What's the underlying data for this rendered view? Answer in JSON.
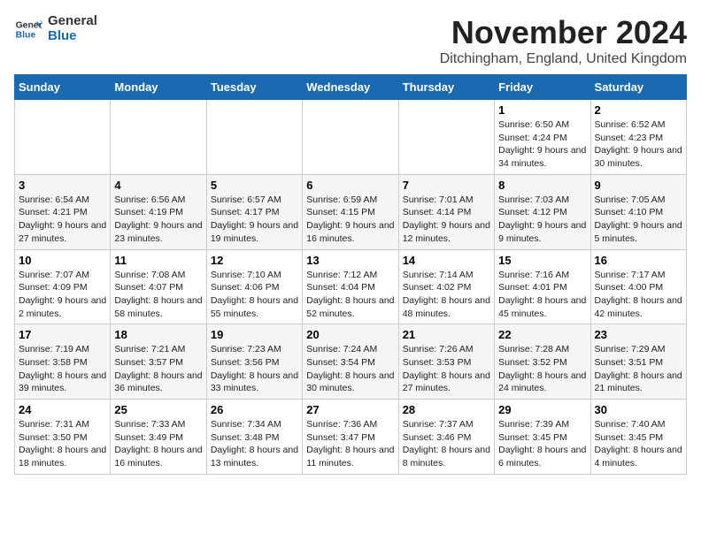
{
  "header": {
    "logo_line1": "General",
    "logo_line2": "Blue",
    "month_title": "November 2024",
    "location": "Ditchingham, England, United Kingdom"
  },
  "days_of_week": [
    "Sunday",
    "Monday",
    "Tuesday",
    "Wednesday",
    "Thursday",
    "Friday",
    "Saturday"
  ],
  "weeks": [
    [
      {
        "day": "",
        "info": ""
      },
      {
        "day": "",
        "info": ""
      },
      {
        "day": "",
        "info": ""
      },
      {
        "day": "",
        "info": ""
      },
      {
        "day": "",
        "info": ""
      },
      {
        "day": "1",
        "info": "Sunrise: 6:50 AM\nSunset: 4:24 PM\nDaylight: 9 hours and 34 minutes."
      },
      {
        "day": "2",
        "info": "Sunrise: 6:52 AM\nSunset: 4:23 PM\nDaylight: 9 hours and 30 minutes."
      }
    ],
    [
      {
        "day": "3",
        "info": "Sunrise: 6:54 AM\nSunset: 4:21 PM\nDaylight: 9 hours and 27 minutes."
      },
      {
        "day": "4",
        "info": "Sunrise: 6:56 AM\nSunset: 4:19 PM\nDaylight: 9 hours and 23 minutes."
      },
      {
        "day": "5",
        "info": "Sunrise: 6:57 AM\nSunset: 4:17 PM\nDaylight: 9 hours and 19 minutes."
      },
      {
        "day": "6",
        "info": "Sunrise: 6:59 AM\nSunset: 4:15 PM\nDaylight: 9 hours and 16 minutes."
      },
      {
        "day": "7",
        "info": "Sunrise: 7:01 AM\nSunset: 4:14 PM\nDaylight: 9 hours and 12 minutes."
      },
      {
        "day": "8",
        "info": "Sunrise: 7:03 AM\nSunset: 4:12 PM\nDaylight: 9 hours and 9 minutes."
      },
      {
        "day": "9",
        "info": "Sunrise: 7:05 AM\nSunset: 4:10 PM\nDaylight: 9 hours and 5 minutes."
      }
    ],
    [
      {
        "day": "10",
        "info": "Sunrise: 7:07 AM\nSunset: 4:09 PM\nDaylight: 9 hours and 2 minutes."
      },
      {
        "day": "11",
        "info": "Sunrise: 7:08 AM\nSunset: 4:07 PM\nDaylight: 8 hours and 58 minutes."
      },
      {
        "day": "12",
        "info": "Sunrise: 7:10 AM\nSunset: 4:06 PM\nDaylight: 8 hours and 55 minutes."
      },
      {
        "day": "13",
        "info": "Sunrise: 7:12 AM\nSunset: 4:04 PM\nDaylight: 8 hours and 52 minutes."
      },
      {
        "day": "14",
        "info": "Sunrise: 7:14 AM\nSunset: 4:02 PM\nDaylight: 8 hours and 48 minutes."
      },
      {
        "day": "15",
        "info": "Sunrise: 7:16 AM\nSunset: 4:01 PM\nDaylight: 8 hours and 45 minutes."
      },
      {
        "day": "16",
        "info": "Sunrise: 7:17 AM\nSunset: 4:00 PM\nDaylight: 8 hours and 42 minutes."
      }
    ],
    [
      {
        "day": "17",
        "info": "Sunrise: 7:19 AM\nSunset: 3:58 PM\nDaylight: 8 hours and 39 minutes."
      },
      {
        "day": "18",
        "info": "Sunrise: 7:21 AM\nSunset: 3:57 PM\nDaylight: 8 hours and 36 minutes."
      },
      {
        "day": "19",
        "info": "Sunrise: 7:23 AM\nSunset: 3:56 PM\nDaylight: 8 hours and 33 minutes."
      },
      {
        "day": "20",
        "info": "Sunrise: 7:24 AM\nSunset: 3:54 PM\nDaylight: 8 hours and 30 minutes."
      },
      {
        "day": "21",
        "info": "Sunrise: 7:26 AM\nSunset: 3:53 PM\nDaylight: 8 hours and 27 minutes."
      },
      {
        "day": "22",
        "info": "Sunrise: 7:28 AM\nSunset: 3:52 PM\nDaylight: 8 hours and 24 minutes."
      },
      {
        "day": "23",
        "info": "Sunrise: 7:29 AM\nSunset: 3:51 PM\nDaylight: 8 hours and 21 minutes."
      }
    ],
    [
      {
        "day": "24",
        "info": "Sunrise: 7:31 AM\nSunset: 3:50 PM\nDaylight: 8 hours and 18 minutes."
      },
      {
        "day": "25",
        "info": "Sunrise: 7:33 AM\nSunset: 3:49 PM\nDaylight: 8 hours and 16 minutes."
      },
      {
        "day": "26",
        "info": "Sunrise: 7:34 AM\nSunset: 3:48 PM\nDaylight: 8 hours and 13 minutes."
      },
      {
        "day": "27",
        "info": "Sunrise: 7:36 AM\nSunset: 3:47 PM\nDaylight: 8 hours and 11 minutes."
      },
      {
        "day": "28",
        "info": "Sunrise: 7:37 AM\nSunset: 3:46 PM\nDaylight: 8 hours and 8 minutes."
      },
      {
        "day": "29",
        "info": "Sunrise: 7:39 AM\nSunset: 3:45 PM\nDaylight: 8 hours and 6 minutes."
      },
      {
        "day": "30",
        "info": "Sunrise: 7:40 AM\nSunset: 3:45 PM\nDaylight: 8 hours and 4 minutes."
      }
    ]
  ]
}
